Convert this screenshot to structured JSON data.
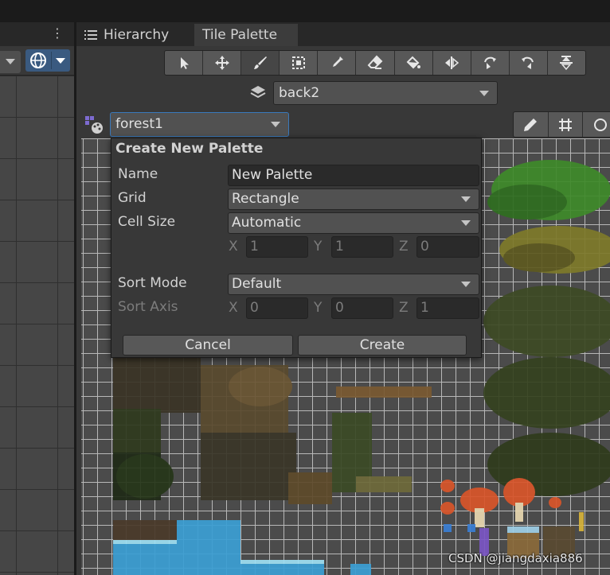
{
  "left_panel": {
    "menu_icon": "kebab-icon",
    "gizmo_icon": "globe-gizmo-icon"
  },
  "tabs": [
    {
      "label": "Hierarchy",
      "icon": "list-icon"
    },
    {
      "label": "Tile Palette"
    }
  ],
  "tools": [
    {
      "name": "select",
      "icon": "arrow-cursor-icon"
    },
    {
      "name": "move",
      "icon": "move-icon"
    },
    {
      "name": "paint",
      "icon": "brush-icon",
      "active": true
    },
    {
      "name": "box-fill",
      "icon": "box-select-icon"
    },
    {
      "name": "picker",
      "icon": "eyedropper-icon"
    },
    {
      "name": "erase",
      "icon": "eraser-icon"
    },
    {
      "name": "fill",
      "icon": "bucket-icon"
    },
    {
      "name": "flip-x",
      "icon": "flip-horizontal-icon"
    },
    {
      "name": "rotate-cw",
      "icon": "rotate-cw-icon"
    },
    {
      "name": "rotate-ccw",
      "icon": "rotate-ccw-icon"
    },
    {
      "name": "flip-y",
      "icon": "flip-vertical-icon"
    }
  ],
  "active_target": {
    "value": "back2",
    "icon": "layer-stack-icon"
  },
  "palette_selector": {
    "value": "forest1",
    "icon": "palette-icon"
  },
  "edit_tools": [
    "pencil-icon",
    "grid-icon",
    "gizmo-icon"
  ],
  "create_palette": {
    "title": "Create New Palette",
    "name_label": "Name",
    "name_value": "New Palette",
    "grid_label": "Grid",
    "grid_value": "Rectangle",
    "cell_size_label": "Cell Size",
    "cell_size_value": "Automatic",
    "cell_x_label": "X",
    "cell_x": "1",
    "cell_y_label": "Y",
    "cell_y": "1",
    "cell_z_label": "Z",
    "cell_z": "0",
    "sort_mode_label": "Sort Mode",
    "sort_mode_value": "Default",
    "sort_axis_label": "Sort Axis",
    "axis_x_label": "X",
    "axis_x": "0",
    "axis_y_label": "Y",
    "axis_y": "0",
    "axis_z_label": "Z",
    "axis_z": "1",
    "cancel_label": "Cancel",
    "create_label": "Create"
  },
  "colors": {
    "accent": "#3a79bb",
    "panel": "#383838",
    "grid_line": "#b8b8b8",
    "foliage_green": "#3f8a2a",
    "water": "#3b9fd4",
    "mushroom": "#d9552a"
  },
  "watermark": "CSDN @jiangdaxia886"
}
